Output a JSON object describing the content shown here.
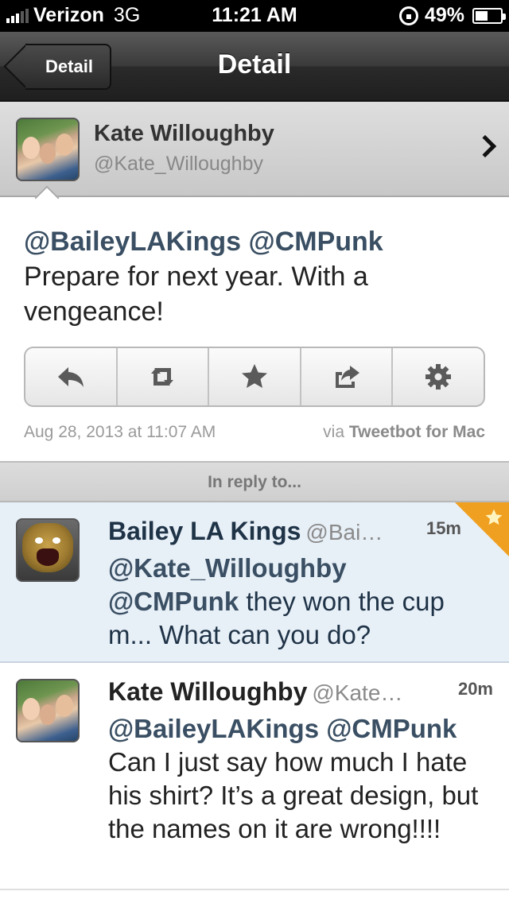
{
  "status_bar": {
    "carrier": "Verizon",
    "network": "3G",
    "time": "11:21 AM",
    "battery": "49%",
    "battery_level": 0.49
  },
  "nav": {
    "back_label": "Detail",
    "title": "Detail"
  },
  "profile": {
    "name": "Kate Willoughby",
    "handle": "@Kate_Willoughby"
  },
  "main_tweet": {
    "mentions": "@BaileyLAKings @CMPunk",
    "text": "Prepare for next year. With a vengeance!",
    "date": "Aug 28, 2013 at 11:07 AM",
    "via_prefix": "via",
    "via_app": "Tweetbot for Mac"
  },
  "actions": [
    "reply-icon",
    "retweet-icon",
    "star-icon",
    "share-icon",
    "gear-icon"
  ],
  "reply_header": "In reply to...",
  "replies": [
    {
      "name": "Bailey LA Kings",
      "handle": "@Bai…",
      "time": "15m",
      "mentions_line1": "@Kate_Willoughby",
      "mentions_line2": "@CMPunk",
      "text": "they won the cup m... What can you do?",
      "favorited": true
    },
    {
      "name": "Kate Willoughby",
      "handle": "@Kate…",
      "time": "20m",
      "mentions": "@BaileyLAKings @CMPunk",
      "text": "Can I just say how much I hate his shirt? It’s a great design, but the names on it are wrong!!!!"
    }
  ],
  "colors": {
    "mention": "#3a4f63",
    "favorite_corner": "#f0a020",
    "reply_row_bg": "#e7eff7"
  }
}
